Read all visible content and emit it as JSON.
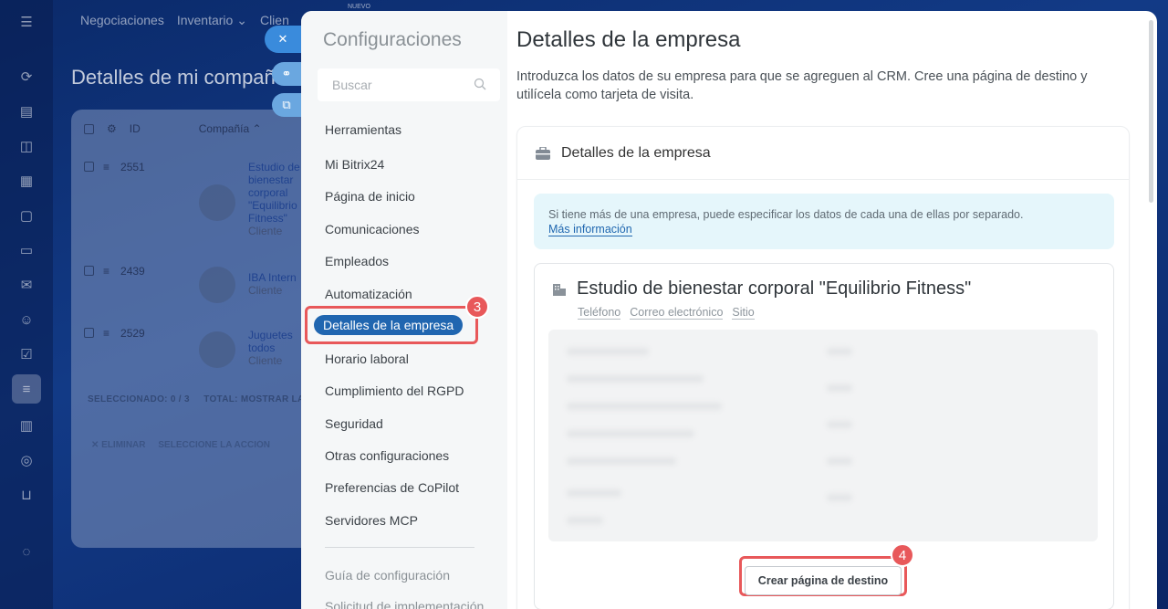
{
  "topnav": [
    "Negociaciones",
    "Inventario ⌄",
    "Clien"
  ],
  "topnav_badge": "NUEVO",
  "bg": {
    "title": "Detalles de mi compañ",
    "col_id": "ID",
    "col_company": "Compañía ⌃",
    "rows": [
      {
        "id": "2551",
        "name": "Estudio de bienestar corporal \"Equilibrio Fitness\"",
        "type": "Cliente"
      },
      {
        "id": "2439",
        "name": "IBA Intern",
        "type": "Cliente"
      },
      {
        "id": "2529",
        "name": "Juguetes todos",
        "type": "Cliente"
      }
    ],
    "footer": "SELECCIONADO: 0 / 3     TOTAL: MOSTRAR LA",
    "actions": "✕ ELIMINAR     SELECCIONE LA ACCIÓN"
  },
  "nav": {
    "title": "Configuraciones",
    "search_placeholder": "Buscar",
    "items": [
      "Herramientas",
      "Mi Bitrix24",
      "Página de inicio",
      "Comunicaciones",
      "Empleados",
      "Automatización",
      "Detalles de la empresa",
      "Horario laboral",
      "Cumplimiento del RGPD",
      "Seguridad",
      "Otras configuraciones",
      "Preferencias de CoPilot",
      "Servidores MCP"
    ],
    "extra_items": [
      "Guía de configuración",
      "Solicitud de implementación"
    ],
    "active_index": 6
  },
  "content": {
    "title": "Detalles de la empresa",
    "intro": "Introduzca los datos de su empresa para que se agreguen al CRM. Cree una página de destino y utilícela como tarjeta de visita.",
    "card_title": "Detalles de la empresa",
    "info_text": "Si tiene más de una empresa, puede especificar los datos de cada una de ellas por separado.",
    "info_link": "Más información",
    "company_name": "Estudio de bienestar corporal \"Equilibrio Fitness\"",
    "company_links": [
      "Teléfono",
      "Correo electrónico",
      "Sitio"
    ],
    "create_button": "Crear página de destino"
  },
  "steps": {
    "nav": "3",
    "button": "4"
  },
  "colors": {
    "accent": "#2066b0",
    "highlight": "#e8585a",
    "info_bg": "#e5f6fb"
  }
}
